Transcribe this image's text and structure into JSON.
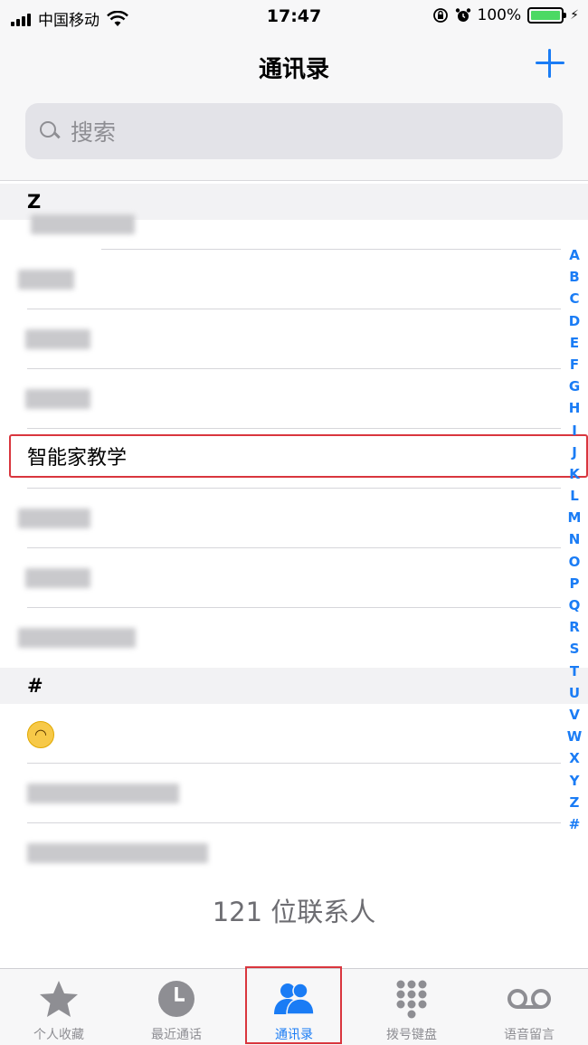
{
  "status_bar": {
    "carrier": "中国移动",
    "time": "17:47",
    "battery": "100%",
    "battery_level": 1.0
  },
  "nav": {
    "title": "通讯录",
    "add_icon": "plus-icon"
  },
  "search": {
    "placeholder": "搜索"
  },
  "sections": [
    {
      "header": "Z"
    },
    {
      "header": "#"
    }
  ],
  "contacts": {
    "highlighted": "智能家教学"
  },
  "index_letters": [
    "A",
    "B",
    "C",
    "D",
    "E",
    "F",
    "G",
    "H",
    "I",
    "J",
    "K",
    "L",
    "M",
    "N",
    "O",
    "P",
    "Q",
    "R",
    "S",
    "T",
    "U",
    "V",
    "W",
    "X",
    "Y",
    "Z",
    "#"
  ],
  "contact_count": "121 位联系人",
  "tabs": [
    {
      "label": "个人收藏",
      "icon": "star-icon",
      "active": false
    },
    {
      "label": "最近通话",
      "icon": "clock-icon",
      "active": false
    },
    {
      "label": "通讯录",
      "icon": "contacts-icon",
      "active": true
    },
    {
      "label": "拨号键盘",
      "icon": "keypad-icon",
      "active": false
    },
    {
      "label": "语音留言",
      "icon": "voicemail-icon",
      "active": false
    }
  ],
  "colors": {
    "accent": "#1a7cf5",
    "highlight_border": "#d9363e"
  }
}
